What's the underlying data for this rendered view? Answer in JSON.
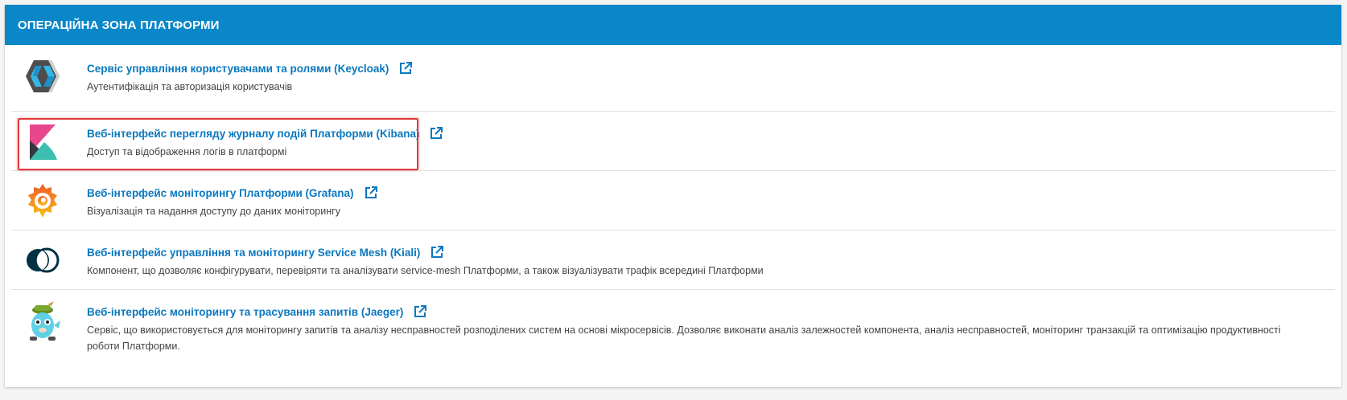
{
  "panel": {
    "title": "ОПЕРАЦІЙНА ЗОНА ПЛАТФОРМИ"
  },
  "items": [
    {
      "title": "Сервіс управління користувачами та ролями (Keycloak)",
      "description": "Аутентифікація та авторизація користувачів",
      "icon": "keycloak-logo",
      "highlighted": false
    },
    {
      "title": "Веб-інтерфейс перегляду журналу подій Платформи (Kibana)",
      "description": "Доступ та відображення логів в платформі",
      "icon": "kibana-logo",
      "highlighted": true
    },
    {
      "title": "Веб-інтерфейс моніторингу Платформи (Grafana)",
      "description": "Візуалізація та надання доступу до даних моніторингу",
      "icon": "grafana-logo",
      "highlighted": false
    },
    {
      "title": "Веб-інтерфейс управління та моніторингу Service Mesh (Kiali)",
      "description": "Компонент, що дозволяє конфігурувати, перевіряти та аналізувати service-mesh Платформи, а також візуалізувати трафік всередині Платформи",
      "icon": "kiali-logo",
      "highlighted": false
    },
    {
      "title": "Веб-інтерфейс моніторингу та трасування запитів (Jaeger)",
      "description": "Сервіс, що використовується для моніторингу запитів та аналізу несправностей розподілених систем на основі мікросервісів. Дозволяє виконати аналіз залежностей компонента, аналіз несправностей, моніторинг транзакцій та оптимізацію продуктивності роботи Платформи.",
      "icon": "jaeger-logo",
      "highlighted": false
    }
  ],
  "colors": {
    "header": "#0a87c9",
    "link": "#0a78bf",
    "highlight": "#e03a3a"
  }
}
